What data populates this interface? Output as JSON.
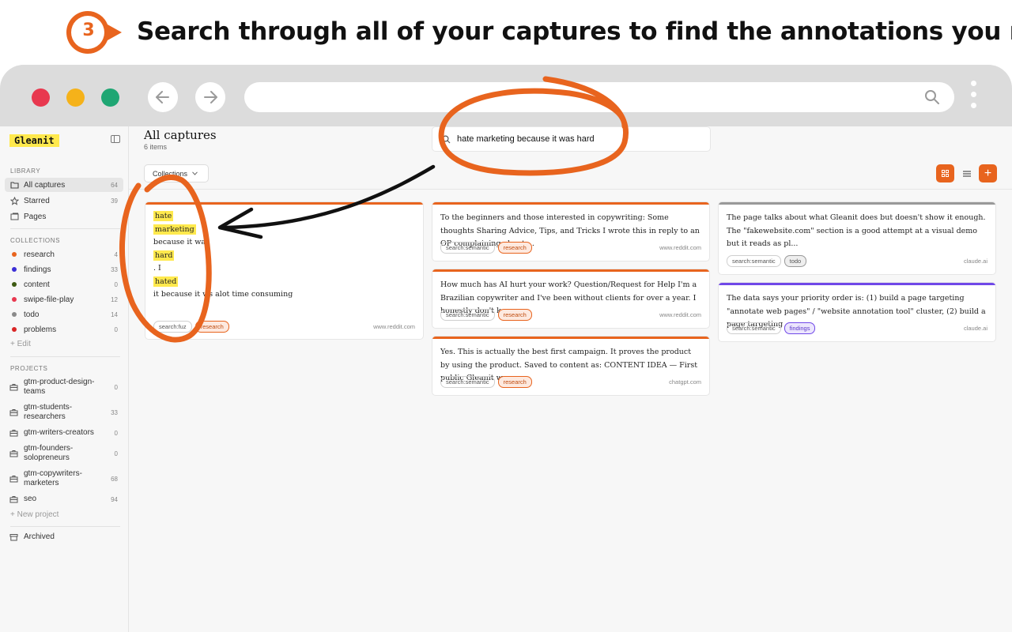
{
  "header": {
    "step_number": "3",
    "headline": "Search through all of your captures to find the annotations you need."
  },
  "browser": {
    "buttons": {
      "back_icon": "arrow-left-icon",
      "forward_icon": "arrow-right-icon",
      "search_icon": "search-icon",
      "menu_icon": "kebab-menu-icon"
    }
  },
  "sidebar": {
    "logo": "Gleanit",
    "library_label": "LIBRARY",
    "library": [
      {
        "label": "All captures",
        "count": "64",
        "icon": "folder-icon"
      },
      {
        "label": "Starred",
        "count": "39",
        "icon": "star-icon"
      },
      {
        "label": "Pages",
        "count": "",
        "icon": "pages-icon"
      }
    ],
    "collections_label": "COLLECTIONS",
    "collections": [
      {
        "label": "research",
        "count": "4",
        "color": "#e8641e"
      },
      {
        "label": "findings",
        "count": "33",
        "color": "#3b2fd6"
      },
      {
        "label": "content",
        "count": "0",
        "color": "#3d5a12"
      },
      {
        "label": "swipe-file-play",
        "count": "12",
        "color": "#e8384f"
      },
      {
        "label": "todo",
        "count": "14",
        "color": "#8a8a8a"
      },
      {
        "label": "problems",
        "count": "0",
        "color": "#d92525"
      }
    ],
    "edit_label": "+ Edit",
    "projects_label": "PROJECTS",
    "projects": [
      {
        "label": "gtm-product-design-teams",
        "count": "0"
      },
      {
        "label": "gtm-students-researchers",
        "count": "33"
      },
      {
        "label": "gtm-writers-creators",
        "count": "0"
      },
      {
        "label": "gtm-founders-solopreneurs",
        "count": "0"
      },
      {
        "label": "gtm-copywriters-marketers",
        "count": "68"
      },
      {
        "label": "seo",
        "count": "94"
      }
    ],
    "new_project_label": "+ New project",
    "archived_label": "Archived"
  },
  "main": {
    "title": "All captures",
    "subtitle": "6 items",
    "search_query": "hate marketing because it was hard",
    "collections_button": "Collections",
    "add_button": "+",
    "cards": [
      {
        "highlight_words": [
          "hate",
          "marketing"
        ],
        "text_1": "because it wa",
        "highlight_3": "hard",
        "text_2": ". I",
        "highlight_4": "hated",
        "text_3": "it because it w",
        "text_3b": "s alot time consuming",
        "chip_search": "search:fuz",
        "chip_collection": "research",
        "domain": "www.reddit.com"
      },
      {
        "text": "To the beginners and those interested in copywriting: Some thoughts Sharing Advice, Tips, and Tricks I wrote this in reply to an OP complaining about ...",
        "chip_search": "search:semantic",
        "chip_collection": "research",
        "domain": "www.reddit.com"
      },
      {
        "text": "How much has AI hurt your work? Question/Request for Help I'm a Brazilian copywriter and I've been without clients for over a year. I honestly don't k...",
        "chip_search": "search:semantic",
        "chip_collection": "research",
        "domain": "www.reddit.com"
      },
      {
        "text": "Yes. This is actually the best first campaign. It proves the product by using the product. Saved to content as: CONTENT IDEA — First public Gleanit wo...",
        "chip_search": "search:semantic",
        "chip_collection": "research",
        "domain": "chatgpt.com"
      },
      {
        "text": "The page talks about what Gleanit does but doesn't show it enough. The \"fakewebsite.com\" section is a good attempt at a visual demo but it reads as pl...",
        "chip_search": "search:semantic",
        "chip_collection": "todo",
        "domain": "claude.ai"
      },
      {
        "text": "The data says your priority order is: (1) build a page targeting \"annotate web pages\" / \"website annotation tool\" cluster, (2) build a page targeting ...",
        "chip_search": "search:semantic",
        "chip_collection": "findings",
        "domain": "claude.ai"
      }
    ]
  },
  "colors": {
    "accent": "#e8641e",
    "highlight": "#ffe94d",
    "purple": "#7048e8"
  }
}
